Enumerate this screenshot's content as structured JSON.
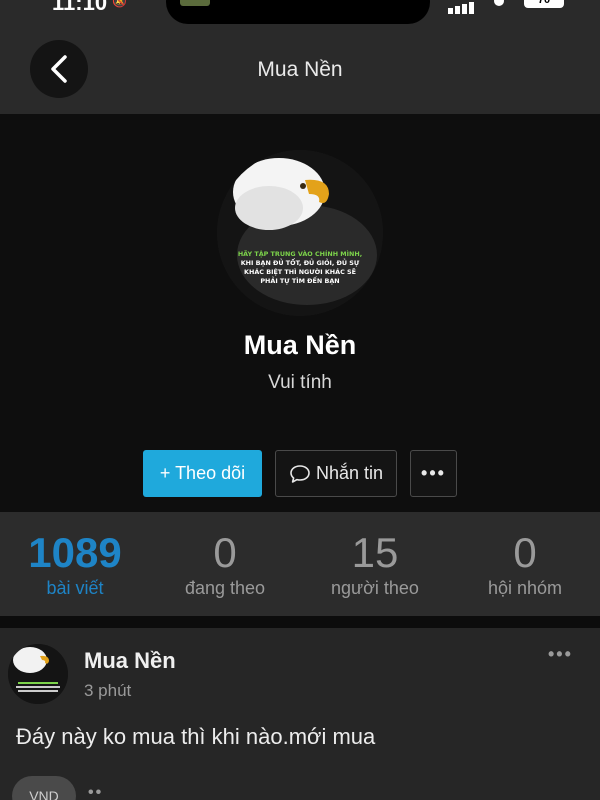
{
  "status_bar": {
    "time": "11:10",
    "battery": "70"
  },
  "nav": {
    "title": "Mua Nền"
  },
  "profile": {
    "name": "Mua Nền",
    "bio": "Vui tính",
    "avatar_text": [
      "HÃY TẬP TRUNG VÀO CHÍNH MÌNH,",
      "KHI BẠN ĐỦ TỐT, ĐỦ GIỎI, ĐỦ SỰ",
      "KHÁC BIỆT THÌ NGƯỜI KHÁC SẼ",
      "PHẢI TỰ TÌM ĐẾN BẠN"
    ],
    "follow_label": "+ Theo dõi",
    "message_label": "Nhắn tin",
    "more_label": "•••"
  },
  "stats": [
    {
      "value": "1089",
      "label": "bài viết",
      "active": true
    },
    {
      "value": "0",
      "label": "đang theo",
      "active": false
    },
    {
      "value": "15",
      "label": "người theo",
      "active": false
    },
    {
      "value": "0",
      "label": "hội nhóm",
      "active": false
    }
  ],
  "post": {
    "author": "Mua Nền",
    "time": "3 phút",
    "content": "Đáy này ko mua thì khi nào.mới mua",
    "menu": "•••",
    "chip": "VND",
    "more": "••"
  },
  "colors": {
    "accent": "#1fa9dc",
    "stat_active": "#1e84c6",
    "background": "#0f0f0f"
  }
}
